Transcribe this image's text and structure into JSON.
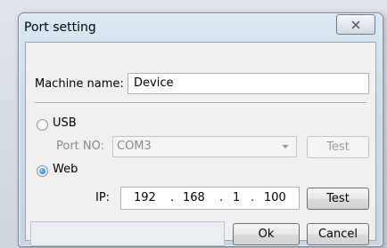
{
  "window": {
    "title": "Port setting"
  },
  "machine": {
    "label": "Machine name:",
    "value": "Device"
  },
  "usb": {
    "label": "USB",
    "selected": false,
    "port_label": "Port NO:",
    "port_value": "COM3",
    "test_label": "Test"
  },
  "web": {
    "label": "Web",
    "selected": true,
    "ip_label": "IP:",
    "ip": [
      "192",
      "168",
      "1",
      "100"
    ],
    "dots": [
      ".",
      ".",
      "."
    ],
    "test_label": "Test"
  },
  "footer": {
    "status_text": "",
    "ok_label": "Ok",
    "cancel_label": "Cancel"
  },
  "icons": {
    "close": "close-icon",
    "dropdown": "chevron-down-icon"
  }
}
